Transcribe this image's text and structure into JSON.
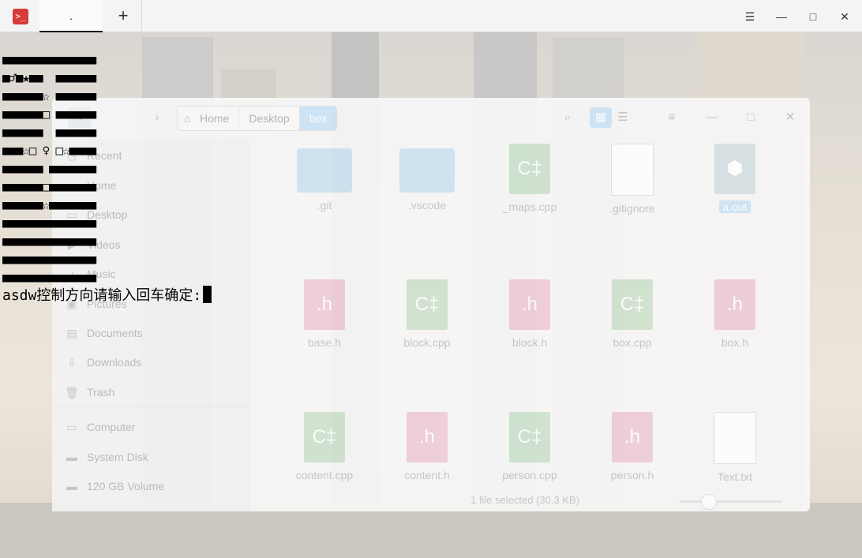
{
  "terminal": {
    "tab_title": ".",
    "app_icon": "terminal-icon",
    "new_tab_label": "+",
    "window_buttons": {
      "menu": "☰",
      "minimize": "—",
      "maximize": "□",
      "close": "✕"
    },
    "grid_rows": [
      "■■■■■■■■■■■■■■",
      "■♂■★■■  ■■■■■■",
      "■■■■■■☆ ■■■■■■",
      "■■■■■■□ ■■■■■■",
      "■■■■■■  ■■■■■■",
      "■■■☆□ ♀ □☆■■■■",
      "■■■■■■ ■■■■■■■",
      "■■■■■■□■■■■■■■",
      "■■■■■■☆■■■■■■■",
      "■■■■■■■■■■■■■■",
      "■■■■■■■■■■■■■■",
      "■■■■■■■■■■■■■■",
      "■■■■■■■■■■■■■■"
    ],
    "prompt": "asdw控制方向请输入回车确定:"
  },
  "file_manager": {
    "breadcrumb": [
      "Home",
      "Desktop",
      "box"
    ],
    "sidebar": [
      {
        "label": "Recent",
        "icon": "clock-icon"
      },
      {
        "label": "Home",
        "icon": "home-icon"
      },
      {
        "label": "Desktop",
        "icon": "desktop-icon"
      },
      {
        "label": "Videos",
        "icon": "video-icon"
      },
      {
        "label": "Music",
        "icon": "music-icon"
      },
      {
        "label": "Pictures",
        "icon": "picture-icon"
      },
      {
        "label": "Documents",
        "icon": "document-icon"
      },
      {
        "label": "Downloads",
        "icon": "download-icon"
      },
      {
        "label": "Trash",
        "icon": "trash-icon"
      },
      {
        "label": "Computer",
        "icon": "computer-icon"
      },
      {
        "label": "System Disk",
        "icon": "disk-icon"
      },
      {
        "label": "120 GB Volume",
        "icon": "disk-icon"
      }
    ],
    "files": [
      {
        "name": ".git",
        "type": "folder"
      },
      {
        "name": ".vscode",
        "type": "folder"
      },
      {
        "name": "_maps.cpp",
        "type": "cpp"
      },
      {
        "name": ".gitignore",
        "type": "blank"
      },
      {
        "name": "a.out",
        "type": "exe",
        "selected": true
      },
      {
        "name": "base.h",
        "type": "h"
      },
      {
        "name": "block.cpp",
        "type": "cpp"
      },
      {
        "name": "block.h",
        "type": "h"
      },
      {
        "name": "box.cpp",
        "type": "cpp"
      },
      {
        "name": "box.h",
        "type": "h"
      },
      {
        "name": "content.cpp",
        "type": "cpp"
      },
      {
        "name": "content.h",
        "type": "h"
      },
      {
        "name": "person.cpp",
        "type": "cpp"
      },
      {
        "name": "person.h",
        "type": "h"
      },
      {
        "name": "Text.txt",
        "type": "blank"
      }
    ],
    "status": "1 file selected (30.3 KB)",
    "file_glyphs": {
      "cpp": "C‡",
      "h": ".h",
      "exe": "⬢"
    }
  }
}
